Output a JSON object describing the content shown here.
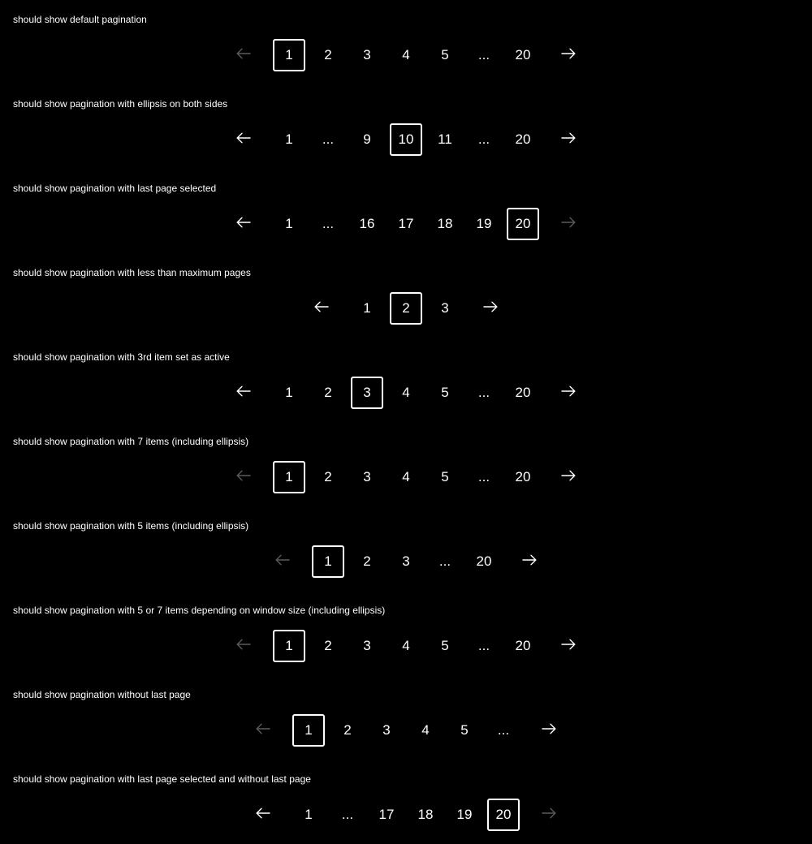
{
  "sections": [
    {
      "title": "should show default pagination",
      "prev_disabled": true,
      "next_disabled": false,
      "items": [
        {
          "label": "1",
          "active": true
        },
        {
          "label": "2"
        },
        {
          "label": "3"
        },
        {
          "label": "4"
        },
        {
          "label": "5"
        },
        {
          "label": "...",
          "ellipsis": true
        },
        {
          "label": "20"
        }
      ]
    },
    {
      "title": "should show pagination with ellipsis on both sides",
      "prev_disabled": false,
      "next_disabled": false,
      "items": [
        {
          "label": "1"
        },
        {
          "label": "...",
          "ellipsis": true
        },
        {
          "label": "9"
        },
        {
          "label": "10",
          "active": true
        },
        {
          "label": "11"
        },
        {
          "label": "...",
          "ellipsis": true
        },
        {
          "label": "20"
        }
      ]
    },
    {
      "title": "should show pagination with last page selected",
      "prev_disabled": false,
      "next_disabled": true,
      "items": [
        {
          "label": "1"
        },
        {
          "label": "...",
          "ellipsis": true
        },
        {
          "label": "16"
        },
        {
          "label": "17"
        },
        {
          "label": "18"
        },
        {
          "label": "19"
        },
        {
          "label": "20",
          "active": true
        }
      ]
    },
    {
      "title": "should show pagination with less than maximum pages",
      "prev_disabled": false,
      "next_disabled": false,
      "items": [
        {
          "label": "1"
        },
        {
          "label": "2",
          "active": true
        },
        {
          "label": "3"
        }
      ]
    },
    {
      "title": "should show pagination with 3rd item set as active",
      "prev_disabled": false,
      "next_disabled": false,
      "items": [
        {
          "label": "1"
        },
        {
          "label": "2"
        },
        {
          "label": "3",
          "active": true
        },
        {
          "label": "4"
        },
        {
          "label": "5"
        },
        {
          "label": "...",
          "ellipsis": true
        },
        {
          "label": "20"
        }
      ]
    },
    {
      "title": "should show pagination with 7 items (including ellipsis)",
      "prev_disabled": true,
      "next_disabled": false,
      "items": [
        {
          "label": "1",
          "active": true
        },
        {
          "label": "2"
        },
        {
          "label": "3"
        },
        {
          "label": "4"
        },
        {
          "label": "5"
        },
        {
          "label": "...",
          "ellipsis": true
        },
        {
          "label": "20"
        }
      ]
    },
    {
      "title": "should show pagination with 5 items (including ellipsis)",
      "prev_disabled": true,
      "next_disabled": false,
      "items": [
        {
          "label": "1",
          "active": true
        },
        {
          "label": "2"
        },
        {
          "label": "3"
        },
        {
          "label": "...",
          "ellipsis": true
        },
        {
          "label": "20"
        }
      ]
    },
    {
      "title": "should show pagination with 5 or 7 items depending on window size (including ellipsis)",
      "prev_disabled": true,
      "next_disabled": false,
      "items": [
        {
          "label": "1",
          "active": true
        },
        {
          "label": "2"
        },
        {
          "label": "3"
        },
        {
          "label": "4"
        },
        {
          "label": "5"
        },
        {
          "label": "...",
          "ellipsis": true
        },
        {
          "label": "20"
        }
      ]
    },
    {
      "title": "should show pagination without last page",
      "prev_disabled": true,
      "next_disabled": false,
      "items": [
        {
          "label": "1",
          "active": true
        },
        {
          "label": "2"
        },
        {
          "label": "3"
        },
        {
          "label": "4"
        },
        {
          "label": "5"
        },
        {
          "label": "...",
          "ellipsis": true
        }
      ]
    },
    {
      "title": "should show pagination with last page selected and without last page",
      "prev_disabled": false,
      "next_disabled": true,
      "items": [
        {
          "label": "1"
        },
        {
          "label": "...",
          "ellipsis": true
        },
        {
          "label": "17"
        },
        {
          "label": "18"
        },
        {
          "label": "19"
        },
        {
          "label": "20",
          "active": true
        }
      ]
    }
  ],
  "icons": {
    "prev": "arrow-left-icon",
    "next": "arrow-right-icon"
  },
  "colors": {
    "background": "#000000",
    "foreground": "#ffffff",
    "disabled": "#5a5a5a"
  }
}
